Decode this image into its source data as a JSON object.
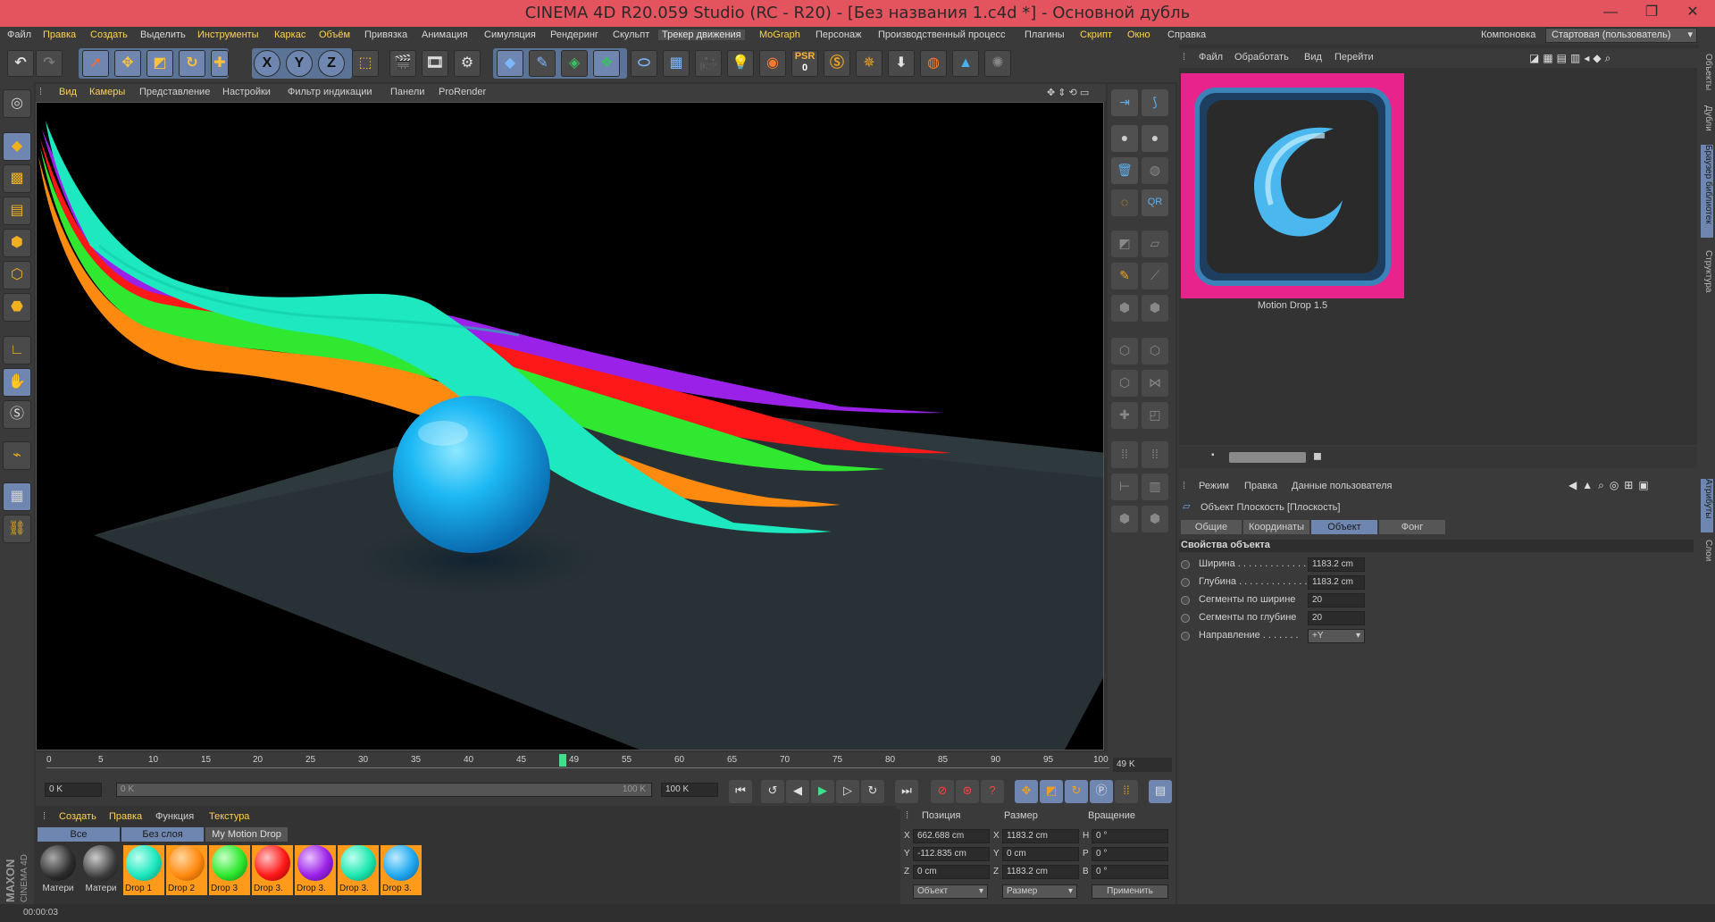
{
  "window": {
    "title": "CINEMA 4D R20.059 Studio (RC - R20) - [Без названия 1.c4d *] - Основной дубль",
    "minimize": "—",
    "maximize": "❐",
    "close": "✕"
  },
  "menu": {
    "items": [
      "Файл",
      "Правка",
      "Создать",
      "Выделить",
      "Инструменты",
      "Каркас",
      "Объём",
      "Привязка",
      "Анимация",
      "Симуляция",
      "Рендеринг",
      "Скульпт",
      "Трекер движения",
      "MoGraph",
      "Персонаж",
      "Производственный процесс",
      "Плагины",
      "Скрипт",
      "Окно",
      "Справка"
    ],
    "layout_label": "Компоновка",
    "layout_value": "Стартовая (пользователь)"
  },
  "toolbar": {
    "axis_x": "X",
    "axis_y": "Y",
    "axis_z": "Z",
    "psr_label": "PSR",
    "psr_value": "0"
  },
  "viewport": {
    "menu": [
      "Вид",
      "Камеры",
      "Представление",
      "Настройки",
      "Фильтр индикации",
      "Панели",
      "ProRender"
    ]
  },
  "timeline": {
    "ticks": [
      "0",
      "5",
      "10",
      "15",
      "20",
      "25",
      "30",
      "35",
      "40",
      "45",
      "49",
      "55",
      "60",
      "65",
      "70",
      "75",
      "80",
      "85",
      "90",
      "95",
      "100"
    ],
    "current_frame": "49 K",
    "start": "0 K",
    "range_start": "0 K",
    "range_end": "100 K",
    "end": "100 K"
  },
  "materials": {
    "menu": [
      "Создать",
      "Правка",
      "Функция",
      "Текстура"
    ],
    "tabs": [
      "Все",
      "Без слоя",
      "My Motion Drop"
    ],
    "items": [
      {
        "label": "Матери",
        "color": "#2a2a2a",
        "plain": true
      },
      {
        "label": "Матери",
        "color": "#3a3a3a",
        "plain": true
      },
      {
        "label": "Drop 1",
        "color": "#1de8c0",
        "plain": false
      },
      {
        "label": "Drop 2",
        "color": "#ff8a10",
        "plain": false
      },
      {
        "label": "Drop 3",
        "color": "#2ee82e",
        "plain": false
      },
      {
        "label": "Drop 3.",
        "color": "#ff1a1a",
        "plain": false
      },
      {
        "label": "Drop 3.",
        "color": "#9a22e8",
        "plain": false
      },
      {
        "label": "Drop 3.",
        "color": "#1de8b0",
        "plain": false
      },
      {
        "label": "Drop 3.",
        "color": "#20a8f0",
        "plain": false
      }
    ]
  },
  "coords": {
    "headers": [
      "Позиция",
      "Размер",
      "Вращение"
    ],
    "rows": [
      {
        "axis": "X",
        "pos": "662.688 cm",
        "size_axis": "X",
        "size": "1183.2 cm",
        "rot_axis": "H",
        "rot": "0 °"
      },
      {
        "axis": "Y",
        "pos": "-112.835 cm",
        "size_axis": "Y",
        "size": "0 cm",
        "rot_axis": "P",
        "rot": "0 °"
      },
      {
        "axis": "Z",
        "pos": "0 cm",
        "size_axis": "Z",
        "size": "1183.2 cm",
        "rot_axis": "B",
        "rot": "0 °"
      }
    ],
    "mode1": "Объект",
    "mode2": "Размер",
    "apply": "Применить"
  },
  "status": {
    "time": "00:00:03"
  },
  "content_browser": {
    "menu": [
      "Файл",
      "Обработать",
      "Вид",
      "Перейти"
    ],
    "item_label": "Motion Drop 1.5"
  },
  "attributes": {
    "menu": [
      "Режим",
      "Правка",
      "Данные пользователя"
    ],
    "object_title": "Объект Плоскость [Плоскость]",
    "tabs": [
      "Общие",
      "Координаты",
      "Объект",
      "Фонг"
    ],
    "active_tab": "Объект",
    "section": "Свойства объекта",
    "props": [
      {
        "label": "Ширина . . . . . . . . . . . . .",
        "value": "1183.2 cm"
      },
      {
        "label": "Глубина . . . . . . . . . . . . .",
        "value": "1183.2 cm"
      },
      {
        "label": "Сегменты по ширине",
        "value": "20"
      },
      {
        "label": "Сегменты по глубине",
        "value": "20"
      },
      {
        "label": "Направление . . . . . . .",
        "value": "+Y"
      }
    ]
  },
  "side_tabs": [
    "Объекты",
    "Дубли",
    "Браузер библиотек",
    "Структура",
    "Атрибуты",
    "Слои"
  ],
  "brand": {
    "line1": "MAXON",
    "line2": "CINEMA 4D"
  },
  "colors": {
    "titlebar": "#e3545f",
    "accent": "#6f87b0",
    "highlight_text": "#ffd24a"
  }
}
